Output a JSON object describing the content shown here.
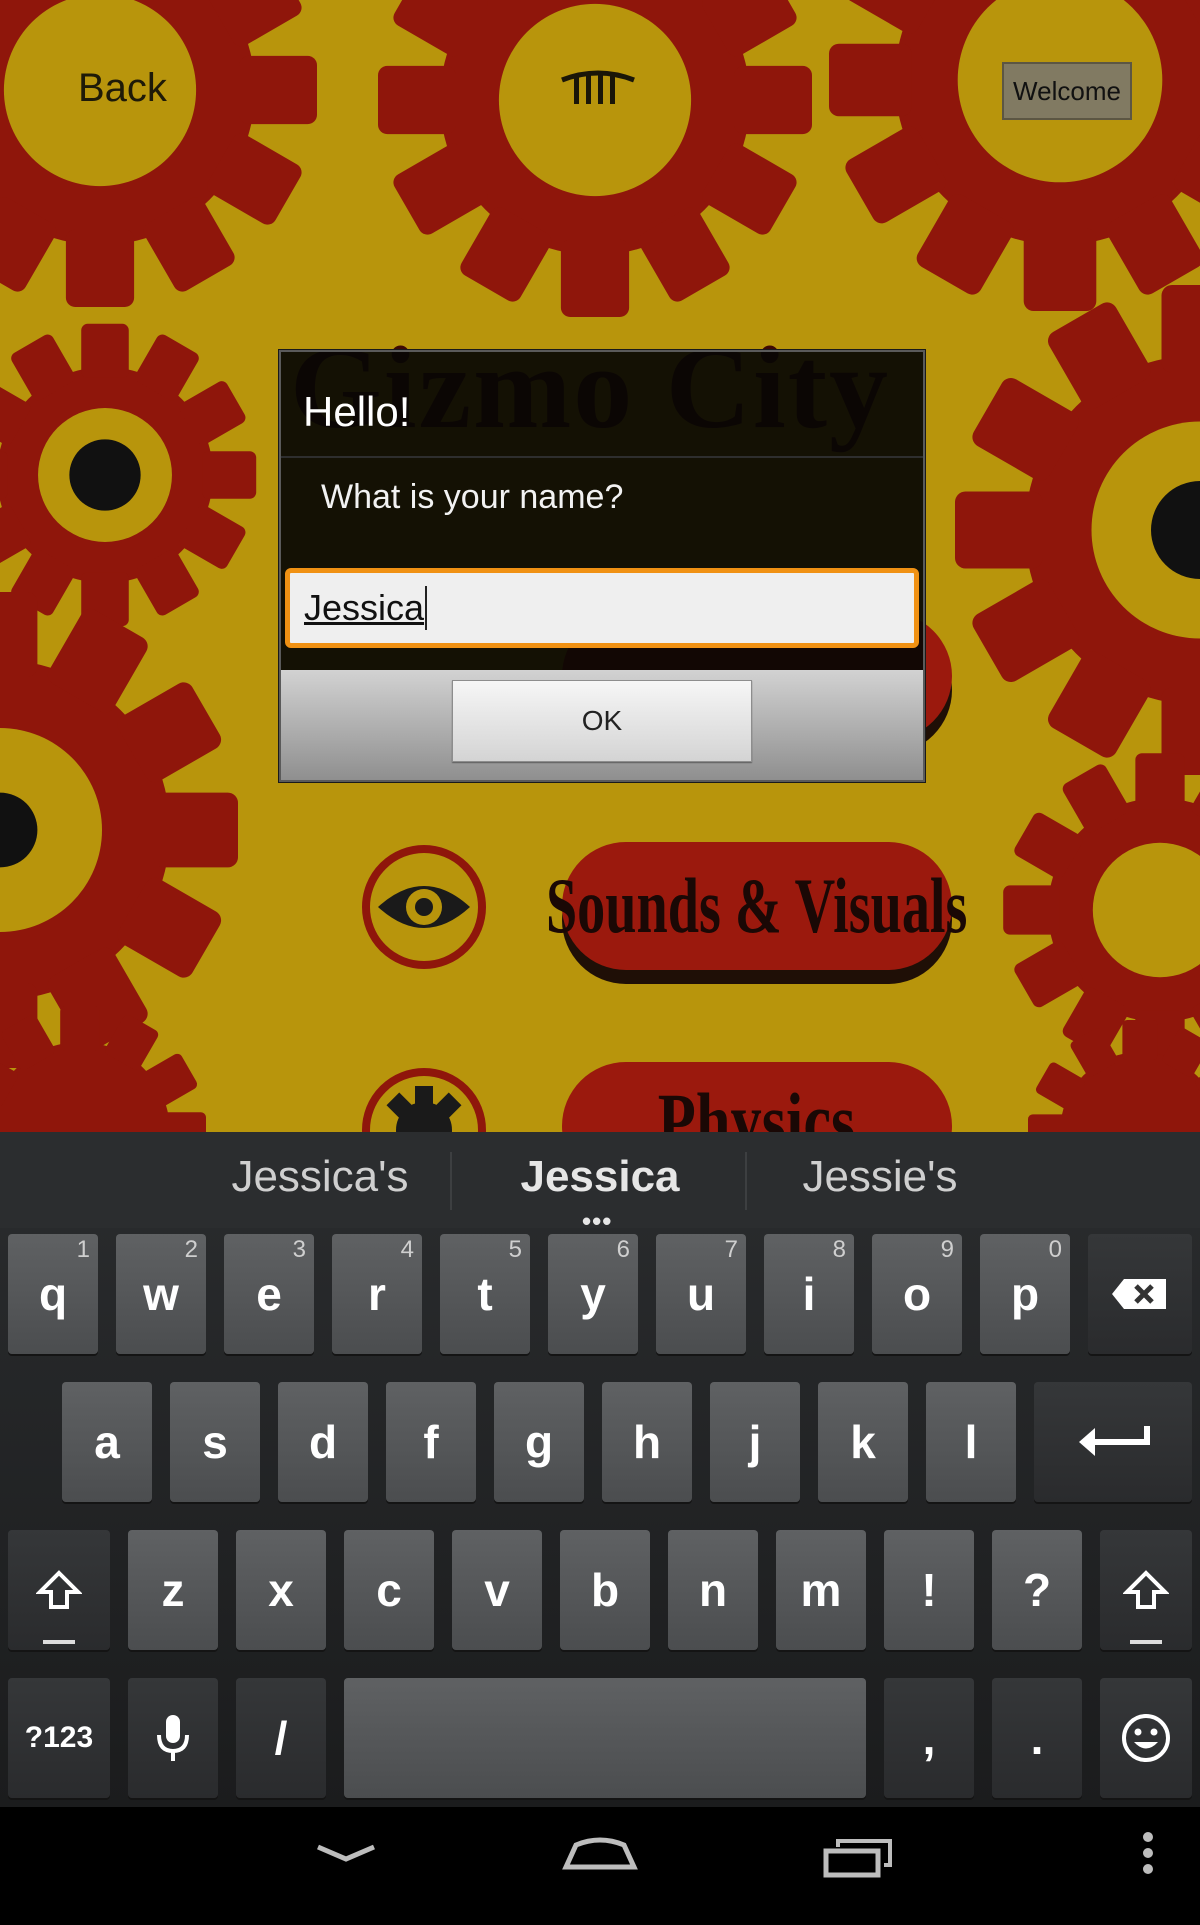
{
  "app": {
    "back_label": "Back",
    "welcome_label": "Welcome",
    "title": "Gizmo City",
    "menu_buttons": [
      {
        "label": "Sounds & Visuals",
        "icon": "eye-icon"
      },
      {
        "label": "Physics",
        "icon": "gear-icon"
      }
    ],
    "colors": {
      "background": "#b8950c",
      "gear": "#8f160b",
      "accent": "#9b190d"
    }
  },
  "dialog": {
    "title": "Hello!",
    "message": "What is your name?",
    "input_value": "Jessica",
    "ok_label": "OK",
    "focus_color": "#f09113"
  },
  "keyboard": {
    "suggestions": [
      "Jessica's",
      "Jessica",
      "Jessie's"
    ],
    "suggestion_more": "•••",
    "row1": [
      {
        "k": "q",
        "h": "1"
      },
      {
        "k": "w",
        "h": "2"
      },
      {
        "k": "e",
        "h": "3"
      },
      {
        "k": "r",
        "h": "4"
      },
      {
        "k": "t",
        "h": "5"
      },
      {
        "k": "y",
        "h": "6"
      },
      {
        "k": "u",
        "h": "7"
      },
      {
        "k": "i",
        "h": "8"
      },
      {
        "k": "o",
        "h": "9"
      },
      {
        "k": "p",
        "h": "0"
      }
    ],
    "row2": [
      "a",
      "s",
      "d",
      "f",
      "g",
      "h",
      "j",
      "k",
      "l"
    ],
    "row3": [
      "z",
      "x",
      "c",
      "v",
      "b",
      "n",
      "m",
      "!",
      "?"
    ],
    "symbols_label": "?123",
    "slash_label": "/",
    "comma_label": ",",
    "period_label": ".",
    "shift_icon": "shift-icon",
    "delete_icon": "backspace-icon",
    "enter_icon": "enter-icon",
    "mic_icon": "microphone-icon",
    "emoji_icon": "emoji-icon"
  },
  "navbar": {
    "icons": [
      "back-icon",
      "home-icon",
      "recents-icon",
      "menu-icon"
    ]
  }
}
